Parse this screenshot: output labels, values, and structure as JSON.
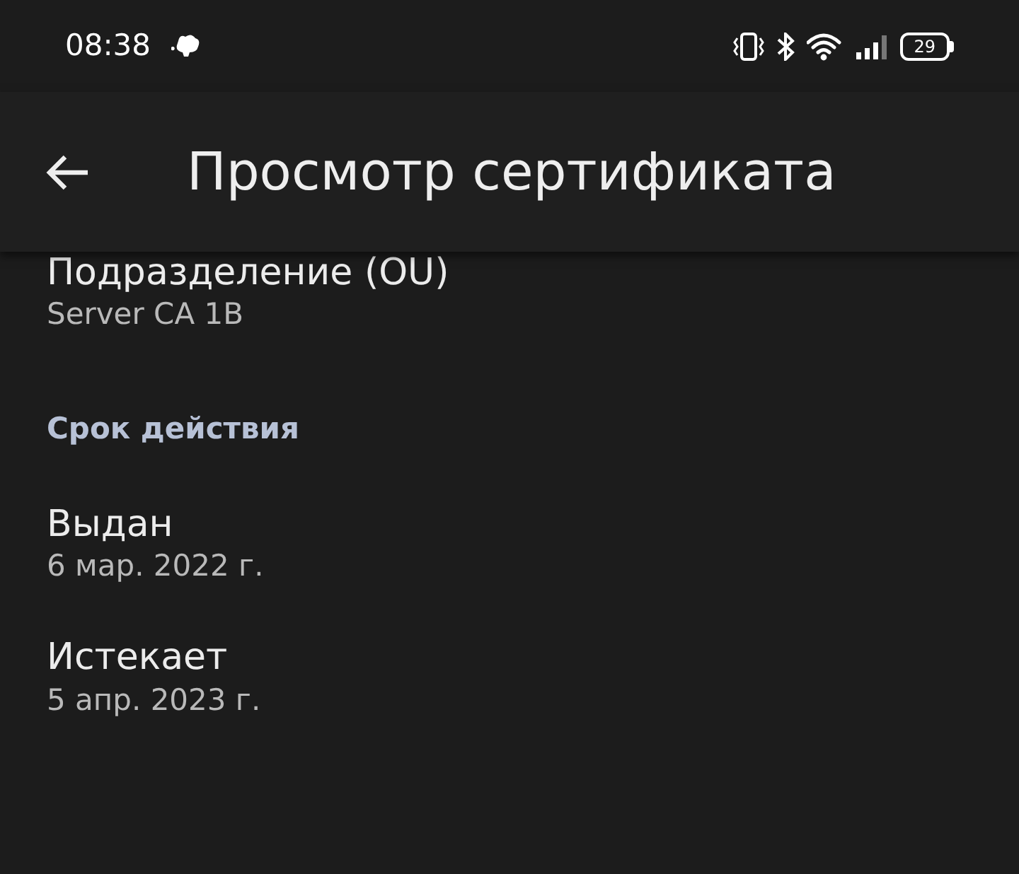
{
  "status_bar": {
    "time": "08:38",
    "battery": "29"
  },
  "app_bar": {
    "title": "Просмотр сертификата"
  },
  "items": [
    {
      "kind": "field",
      "label": "Подразделение (OU)",
      "value": "Server CA 1B"
    },
    {
      "kind": "section",
      "label": "Срок действия"
    },
    {
      "kind": "field",
      "label": "Выдан",
      "value": "6 мар. 2022 г."
    },
    {
      "kind": "field",
      "label": "Истекает",
      "value": "5 апр. 2023 г."
    }
  ]
}
